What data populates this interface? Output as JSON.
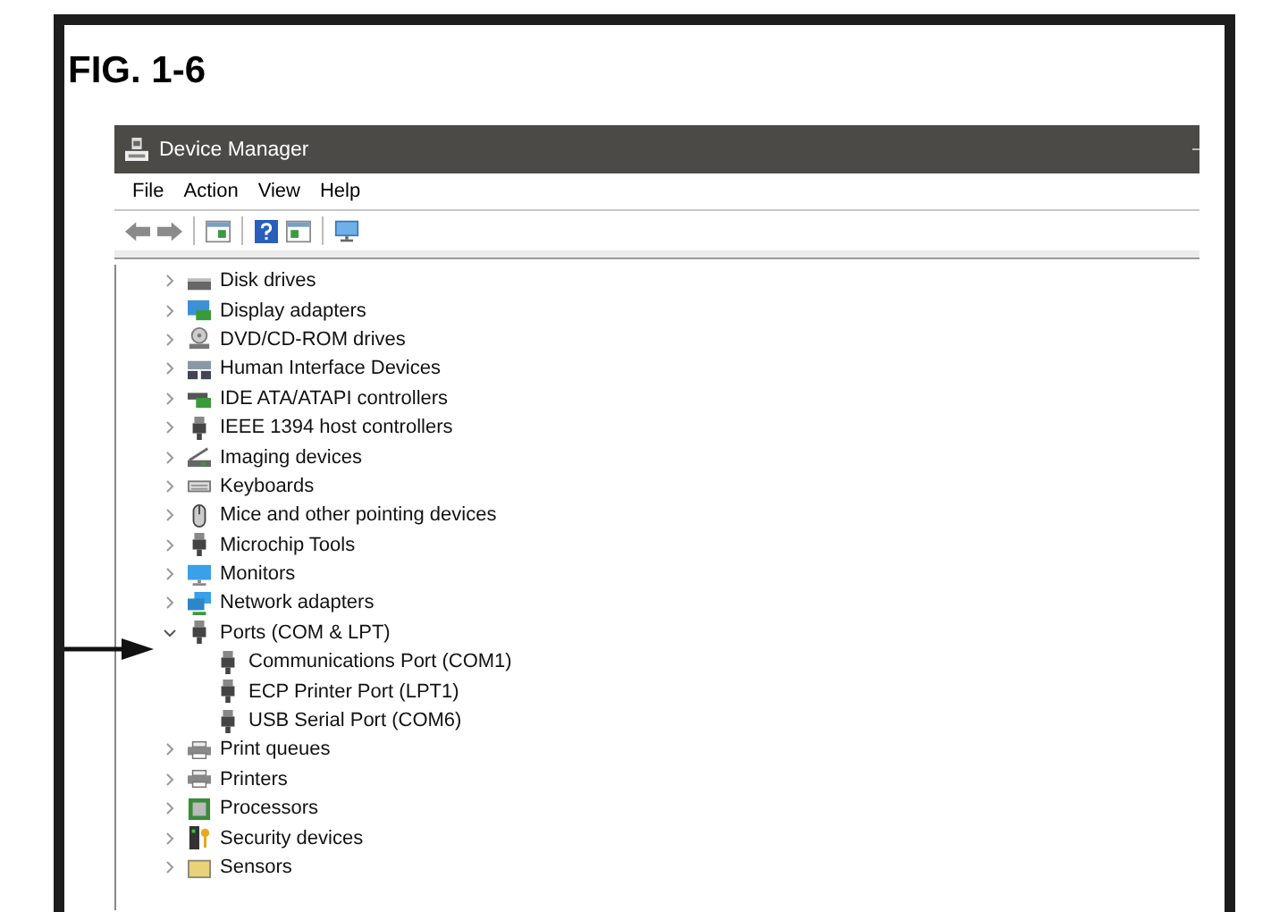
{
  "figure": {
    "label": "FIG. 1-6"
  },
  "window": {
    "title": "Device Manager"
  },
  "menu": [
    "File",
    "Action",
    "View",
    "Help"
  ],
  "tree": [
    {
      "label": "Disk drives",
      "expanded": false
    },
    {
      "label": "Display adapters",
      "expanded": false
    },
    {
      "label": "DVD/CD-ROM drives",
      "expanded": false
    },
    {
      "label": "Human Interface Devices",
      "expanded": false
    },
    {
      "label": "IDE ATA/ATAPI controllers",
      "expanded": false
    },
    {
      "label": "IEEE 1394 host controllers",
      "expanded": false
    },
    {
      "label": "Imaging devices",
      "expanded": false
    },
    {
      "label": "Keyboards",
      "expanded": false
    },
    {
      "label": "Mice and other pointing devices",
      "expanded": false
    },
    {
      "label": "Microchip Tools",
      "expanded": false
    },
    {
      "label": "Monitors",
      "expanded": false
    },
    {
      "label": "Network adapters",
      "expanded": false
    },
    {
      "label": "Ports (COM & LPT)",
      "expanded": true,
      "children": [
        {
          "label": "Communications Port (COM1)"
        },
        {
          "label": "ECP Printer Port (LPT1)"
        },
        {
          "label": "USB Serial Port (COM6)"
        }
      ]
    },
    {
      "label": "Print queues",
      "expanded": false
    },
    {
      "label": "Printers",
      "expanded": false
    },
    {
      "label": "Processors",
      "expanded": false
    },
    {
      "label": "Security devices",
      "expanded": false
    },
    {
      "label": "Sensors",
      "expanded": false
    }
  ]
}
